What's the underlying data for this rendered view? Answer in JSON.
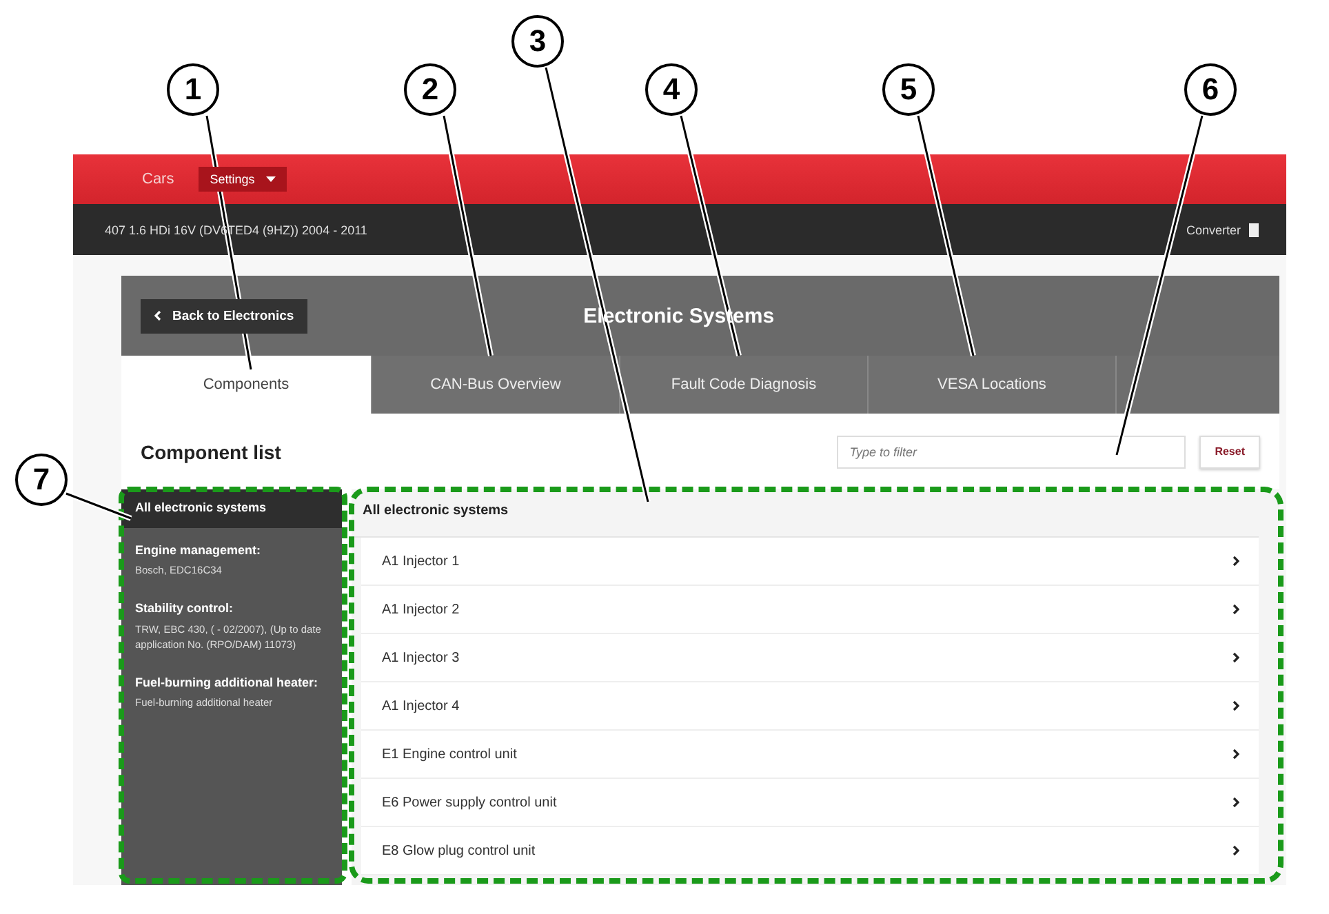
{
  "callouts": [
    "1",
    "2",
    "3",
    "4",
    "5",
    "6",
    "7"
  ],
  "top_bar": {
    "brand": "Cars",
    "settings_button": "Settings"
  },
  "vehicle_bar": {
    "vehicle": "407 1.6 HDi 16V (DV6TED4 (9HZ)) 2004 - 2011",
    "converter": "Converter"
  },
  "header": {
    "back_button": "Back to Electronics",
    "title": "Electronic Systems"
  },
  "tabs": [
    {
      "label": "Components",
      "selected": true
    },
    {
      "label": "CAN-Bus Overview",
      "selected": false
    },
    {
      "label": "Fault Code Diagnosis",
      "selected": false
    },
    {
      "label": "VESA Locations",
      "selected": false
    }
  ],
  "component_list": {
    "title": "Component list",
    "filter": {
      "placeholder": "Type to filter"
    },
    "reset_button": "Reset"
  },
  "sidebar": {
    "items": [
      {
        "label": "All electronic systems",
        "selected": true
      }
    ],
    "groups": [
      {
        "title": "Engine management:",
        "text": "Bosch, EDC16C34"
      },
      {
        "title": "Stability control:",
        "text": "TRW, EBC 430, ( - 02/2007), (Up to date application No. (RPO/DAM) 11073)"
      },
      {
        "title": "Fuel-burning additional heater:",
        "text": "Fuel-burning additional heater"
      }
    ]
  },
  "list": {
    "heading": "All electronic systems",
    "items": [
      "A1 Injector 1",
      "A1 Injector 2",
      "A1 Injector 3",
      "A1 Injector 4",
      "E1 Engine control unit",
      "E6 Power supply control unit",
      "E8 Glow plug control unit"
    ]
  }
}
